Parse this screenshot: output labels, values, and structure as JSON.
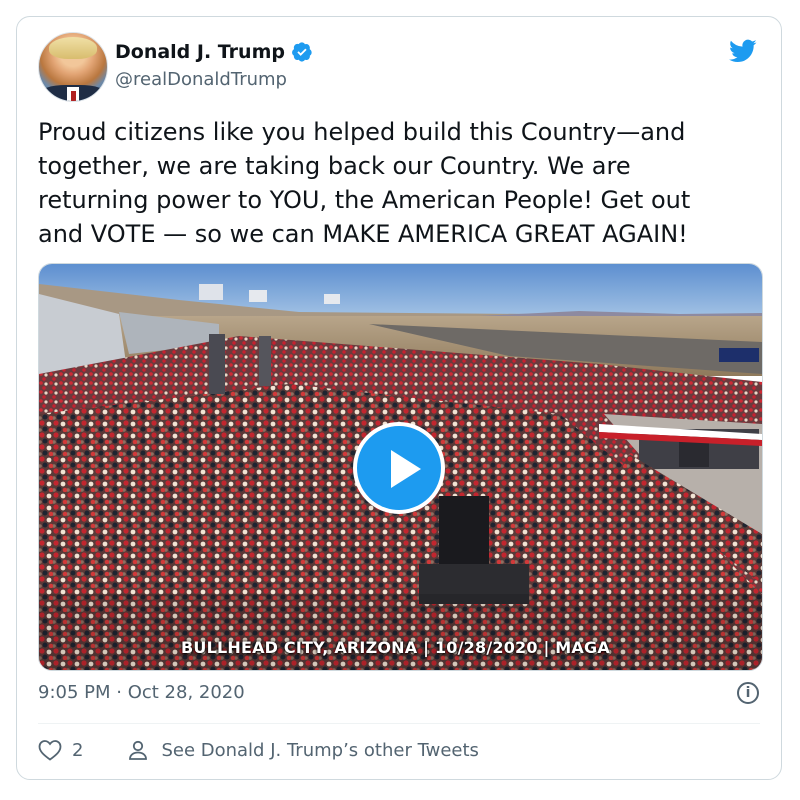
{
  "author": {
    "display_name": "Donald J. Trump",
    "handle": "@realDonaldTrump",
    "verified": true
  },
  "tweet": {
    "text": "Proud citizens like you helped build this Country—and\ntogether, we are taking back our Country. We are\nreturning power to YOU, the American People! Get out\nand VOTE — so we can MAKE AMERICA GREAT AGAIN!"
  },
  "media": {
    "type": "video",
    "caption": "BULLHEAD CITY, ARIZONA | 10/28/2020 | MAGA",
    "icon": "play-icon"
  },
  "meta": {
    "timestamp": "9:05 PM · Oct 28, 2020",
    "info_icon": "info-icon"
  },
  "actions": {
    "like_count": "2",
    "other_tweets_label": "See Donald J. Trump’s other Tweets"
  },
  "colors": {
    "accent": "#1d9bf0",
    "text": "#0f1419",
    "secondary_text": "#536471",
    "border": "#cfd9de"
  }
}
